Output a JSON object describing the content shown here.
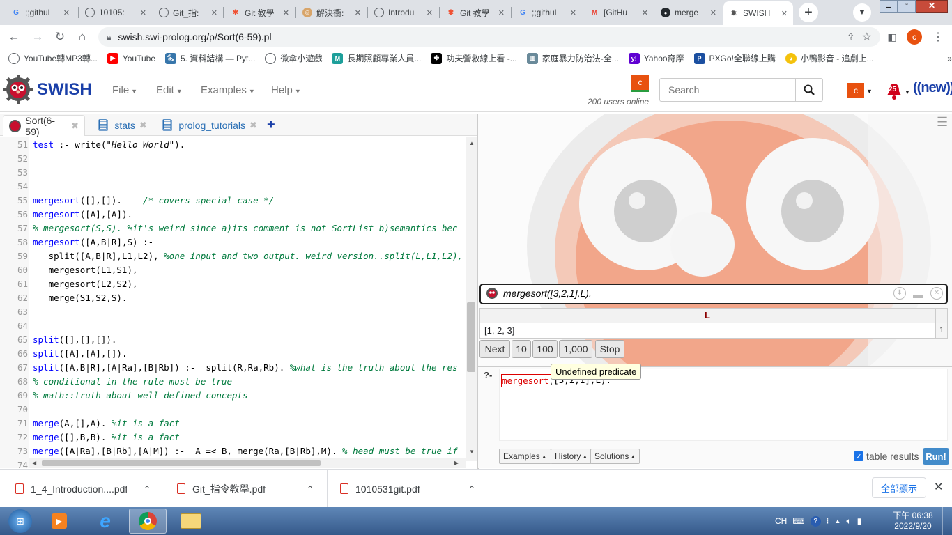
{
  "browser": {
    "tabs": [
      {
        "title": ";;githul",
        "icon": "google-icon"
      },
      {
        "title": "10105:",
        "icon": "globe-icon"
      },
      {
        "title": "Git_指:",
        "icon": "globe-icon"
      },
      {
        "title": "Git 教學",
        "icon": "git-icon"
      },
      {
        "title": "解決衝:",
        "icon": "avatar-icon"
      },
      {
        "title": "Introdu",
        "icon": "globe-icon"
      },
      {
        "title": "Git 教學",
        "icon": "git-icon"
      },
      {
        "title": ";;githul",
        "icon": "google-icon"
      },
      {
        "title": "[GitHu",
        "icon": "gmail-icon"
      },
      {
        "title": "merge",
        "icon": "github-icon"
      },
      {
        "title": "SWISH",
        "icon": "swish-icon",
        "active": true
      }
    ],
    "url": "swish.swi-prolog.org/p/Sort(6-59).pl",
    "profile_letter": "c",
    "bookmarks": [
      "YouTube轉MP3轉...",
      "YouTube",
      "5. 資料結構 — Pyt...",
      "微傘小遊戲",
      "長期照顧專業人員...",
      "功夫營救線上看 -...",
      "家庭暴力防治法-全...",
      "Yahoo奇摩",
      "PXGo!全聯線上購",
      "小鴨影音 - 追劇上..."
    ]
  },
  "swish": {
    "logo_text": "SWISH",
    "menus": [
      "File",
      "Edit",
      "Examples",
      "Help"
    ],
    "user_avatar_letter": "c",
    "users_online": "200 users online",
    "search_placeholder": "Search",
    "notify_count": "25",
    "new_label": "new",
    "editor_tabs": [
      {
        "label": "Sort(6-59)",
        "active": true
      },
      {
        "label": "stats"
      },
      {
        "label": "prolog_tutorials"
      }
    ],
    "code_lines": [
      {
        "n": "51",
        "text": "test :- write(\"Hello World\")."
      },
      {
        "n": "52",
        "text": ""
      },
      {
        "n": "53",
        "text": ""
      },
      {
        "n": "54",
        "text": ""
      },
      {
        "n": "55",
        "text": "mergesort([],[]).    /* covers special case */"
      },
      {
        "n": "56",
        "text": "mergesort([A],[A])."
      },
      {
        "n": "57",
        "text": "% mergesort(S,S). %it's weird since a)its comment is not SortList b)semantics bec"
      },
      {
        "n": "58",
        "text": "mergesort([A,B|R],S) :-"
      },
      {
        "n": "59",
        "text": "   split([A,B|R],L1,L2), %one input and two output. weird version..split(L,L1,L2),"
      },
      {
        "n": "60",
        "text": "   mergesort(L1,S1),"
      },
      {
        "n": "61",
        "text": "   mergesort(L2,S2),"
      },
      {
        "n": "62",
        "text": "   merge(S1,S2,S)."
      },
      {
        "n": "63",
        "text": ""
      },
      {
        "n": "64",
        "text": ""
      },
      {
        "n": "65",
        "text": "split([],[],[])."
      },
      {
        "n": "66",
        "text": "split([A],[A],[])."
      },
      {
        "n": "67",
        "text": "split([A,B|R],[A|Ra],[B|Rb]) :-  split(R,Ra,Rb). %what is the truth about the res"
      },
      {
        "n": "68",
        "text": "% conditional in the rule must be true"
      },
      {
        "n": "69",
        "text": "% math::truth about well-defined concepts"
      },
      {
        "n": "70",
        "text": ""
      },
      {
        "n": "71",
        "text": "merge(A,[],A). %it is a fact"
      },
      {
        "n": "72",
        "text": "merge([],B,B). %it is a fact"
      },
      {
        "n": "73",
        "text": "merge([A|Ra],[B|Rb],[A|M]) :-  A =< B, merge(Ra,[B|Rb],M). % head must be true if"
      },
      {
        "n": "74",
        "text": ""
      }
    ],
    "query_runner": {
      "query": "mergesort([3,2,1],L).",
      "column_header": "L",
      "result_row": "[1, 2, 3]",
      "result_index": "1",
      "buttons": [
        "Next",
        "10",
        "100",
        "1,000",
        "Stop"
      ]
    },
    "query_editor": {
      "prompt": "?-",
      "text": "mergesort([3,2,1],L).",
      "tooltip": "Undefined predicate",
      "buttons": [
        "Examples",
        "History",
        "Solutions"
      ],
      "table_results_label": "table results",
      "table_results_checked": true,
      "run_label": "Run!"
    }
  },
  "downloads": {
    "items": [
      "1_4_Introduction....pdf",
      "Git_指令教學.pdf",
      "1010531git.pdf"
    ],
    "show_all": "全部顯示"
  },
  "taskbar": {
    "ime": "CH",
    "time": "下午 06:38",
    "date": "2022/9/20"
  },
  "colors": {
    "swish_red": "#c8102e",
    "accent_blue": "#1a3fa8",
    "run_button": "#428bca",
    "code_head": "#0000ff",
    "code_comment": "#007a3d"
  }
}
